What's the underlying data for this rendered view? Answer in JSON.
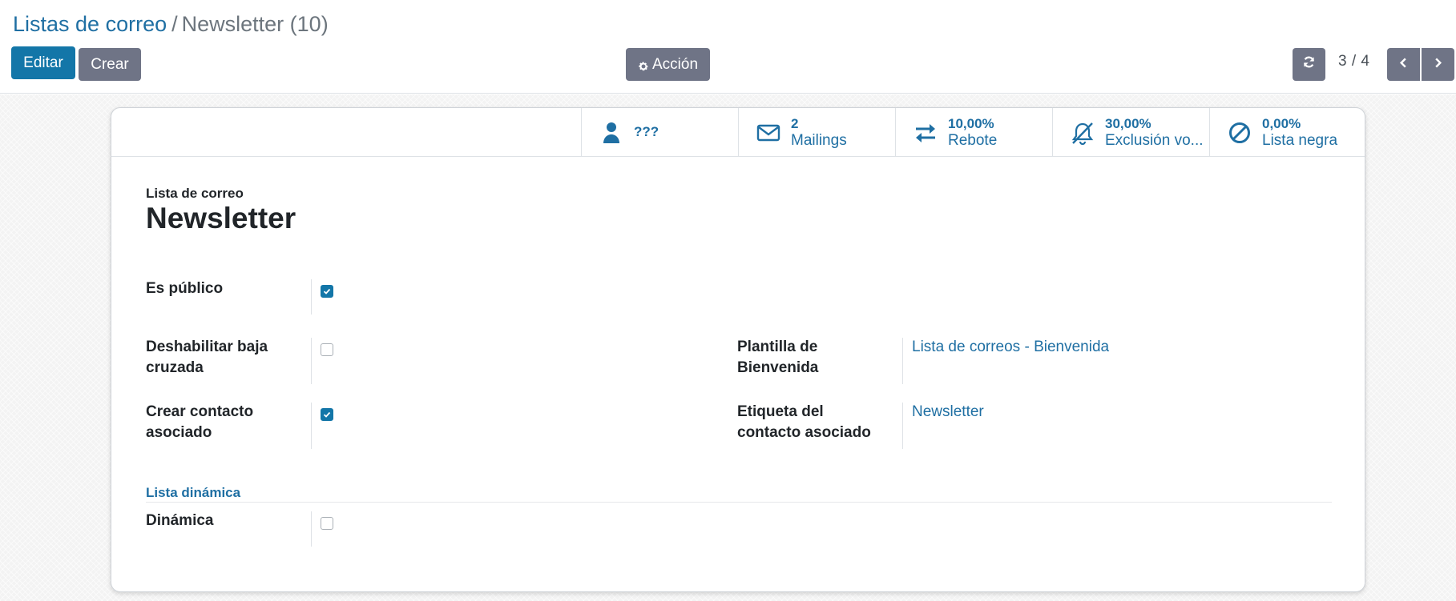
{
  "breadcrumb": {
    "parent": "Listas de correo",
    "separator": "/",
    "current": "Newsletter (10)"
  },
  "toolbar": {
    "edit_label": "Editar",
    "create_label": "Crear",
    "action_label": "Acción",
    "action_icon": "gear-icon"
  },
  "pager": {
    "value": "3 / 4",
    "refresh_icon": "refresh-icon",
    "prev_icon": "chevron-left-icon",
    "next_icon": "chevron-right-icon"
  },
  "stats": {
    "contacts": {
      "icon": "user-icon",
      "value": "???"
    },
    "mailings": {
      "icon": "envelope-icon",
      "value": "2",
      "label": "Mailings"
    },
    "bounce": {
      "icon": "exchange-icon",
      "value": "10,00%",
      "label": "Rebote"
    },
    "optout": {
      "icon": "bell-slash-icon",
      "value": "30,00%",
      "label": "Exclusión vo..."
    },
    "blacklist": {
      "icon": "ban-icon",
      "value": "0,00%",
      "label": "Lista negra"
    }
  },
  "form": {
    "name_label": "Lista de correo",
    "name_value": "Newsletter",
    "is_public": {
      "label": "Es público",
      "checked": true
    },
    "disable_cross": {
      "label_line1": "Deshabilitar baja",
      "label_line2": "cruzada",
      "checked": false
    },
    "create_contact": {
      "label_line1": "Crear contacto",
      "label_line2": "asociado",
      "checked": true
    },
    "welcome_template": {
      "label_line1": "Plantilla de",
      "label_line2": "Bienvenida",
      "value": "Lista de correos - Bienvenida"
    },
    "contact_tag": {
      "label_line1": "Etiqueta del",
      "label_line2": "contacto asociado",
      "value": "Newsletter"
    },
    "dynamic_section": "Lista dinámica",
    "dynamic": {
      "label": "Dinámica",
      "checked": false
    }
  },
  "colors": {
    "primary": "#1376a8",
    "secondary": "#6f7486",
    "link": "#1f6fa3"
  }
}
